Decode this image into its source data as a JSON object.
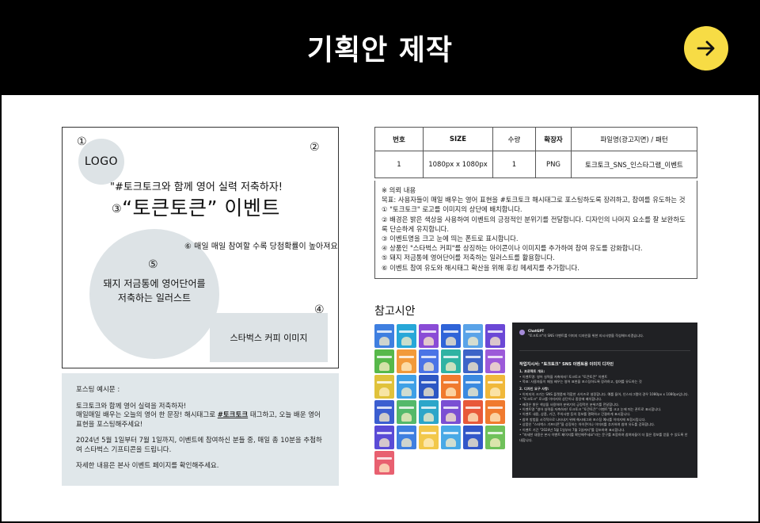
{
  "header": {
    "title": "기획안 제작"
  },
  "card": {
    "markers": [
      "①",
      "②",
      "③",
      "④",
      "⑤",
      "⑥"
    ],
    "logo": "LOGO",
    "subtitle": "\"#토크토크와 함께 영어 실력 저축하자!",
    "event_title": "“토큰토큰” 이벤트",
    "note6": "매일 매일 참여할 수록 당첨확률이 높아져요",
    "illust_label": "돼지 저금통에 영어단어를 저축하는 일러스트",
    "coffee_label": "스타벅스 커피 이미지"
  },
  "post": {
    "heading": "포스팅 예시문 :",
    "line1": "토크토크와 함께 영어 실력을 저축하자!",
    "line2a": "매일매일 배우는 오늘의 영어 한 문장! 해시태그로 ",
    "line2tag": "#토크토크",
    "line2b": " 태그하고, 오늘 배운 영어 표현을 포스팅해주세요!",
    "line3": "2024년 5월 1일부터 7월 1일까지, 이벤트에 참여하신 분들 중, 매일 총 10분을 추첨하여 스타벅스 기프티콘을 드립니다.",
    "line4": "자세한 내용은 본사 이벤트 페이지를 확인해주세요."
  },
  "spec": {
    "headers": [
      "번호",
      "SIZE",
      "수량",
      "확장자",
      "파일명(광고지면) / 패턴"
    ],
    "row": [
      "1",
      "1080px x 1080px",
      "1",
      "PNG",
      "토크토크_SNS_인스타그램_이벤트"
    ]
  },
  "request": {
    "lines": [
      "※ 의뢰 내용",
      "목표: 사용자들이 매일 배우는 영어 표현을 #토크토크 해시태그로 포스팅하도록 장려하고, 참여를 유도하는 것",
      "① \"토크토크\" 로고를 이미지의 상단에 배치합니다.",
      "② 배경은 밝은 색상을 사용하여 이벤트의 긍정적인 분위기를 전달합니다. 디자인의 나머지 요소를 잘 보완하도록 단순하게 유지합니다.",
      "③ 이벤트명을 크고 눈에 띄는 폰트로 표시합니다.",
      "④ 상품인 \"스타벅스 커피\"를 상징하는 아이콘이나 이미지를 추가하여 참여 유도를 강화합니다.",
      "⑤ 돼지 저금통에 영어단어를 저축하는 일러스트를 활용합니다.",
      "⑥ 이벤트 참여 유도와 해시태그 확산을 위해 후킹 메세지를 추가합니다."
    ]
  },
  "reference": {
    "title": "참고시안"
  },
  "chat": {
    "name": "ChatGPT",
    "intro": "\"토크토크\"의 SNS 이벤트를 이미지 디자인을 위한 지시사항을 작성해드리겠습니다.",
    "heading": "작업지시서: \"토크토크\" SNS 이벤트용 이미지 디자인",
    "s1": "1. 프로젝트 개요:",
    "s1a": "• 이벤트명: 영어 실력을 저축하자! 토크토크 \"토큰토큰\" 이벤트",
    "s1b": "• 목표: 사용자들이 매일 배우는 영어 표현을 포스팅하도록 장려하고, 참여를 유도하는 것",
    "s2": "2. 디자인 요구 사항:",
    "s2a": "• 이미지의 크기는 SNS 플랫폼에 적합한 사이즈로 설정합니다. 예를 들어, 인스타그램의 경우 1080px x 1080px입니다.",
    "s2b": "• \"토크토크\" 로고를 이미지의 상단이나 중앙에 배치합니다.",
    "s2c": "• 배경은 밝은 색상을 사용하여 분위기의 긍정적인 분위기를 전달합니다.",
    "s2d": "• 이벤트명 \"영어 실력을 저축하자! 토크토크 \"토큰토큰\" 이벤트\"를 크고 눈에 띄는 폰트로 표시합니다.",
    "s2e": "• 이벤트 내용, 상품, 기간, 주의사항 등의 정보를 명확하고 간결하게 표시합니다.",
    "s2f": "• 참여 방법을 시각적으로 나타내기 위해 해시태그와 포스팅 예시를 이미지에 포함시킵니다.",
    "s2g": "• 상품인 \"스타벅스 기프티콘\"을 상징하는 아이콘이나 이미지를 추가하여 참여 유도를 강화합니다.",
    "s2h": "• 이벤트 기간 \"2024년 5월 1일부터 7월 1일까지\"를 강조하여 표시합니다.",
    "s2i": "• \"자세한 내용은 본사 이벤트 페이지를 확인해주세요\"라는 문구를 포함하여 참여자들이 더 많은 정보를 얻을 수 있도록 안내합니다."
  },
  "colors": {
    "header_bg": "#000000",
    "accent_button": "#f7dc45",
    "placeholder_gray": "#dde3e6",
    "post_bg": "#e0e7ea",
    "chat_bg": "#202124"
  },
  "icons": {
    "next": "arrow-right-icon"
  }
}
